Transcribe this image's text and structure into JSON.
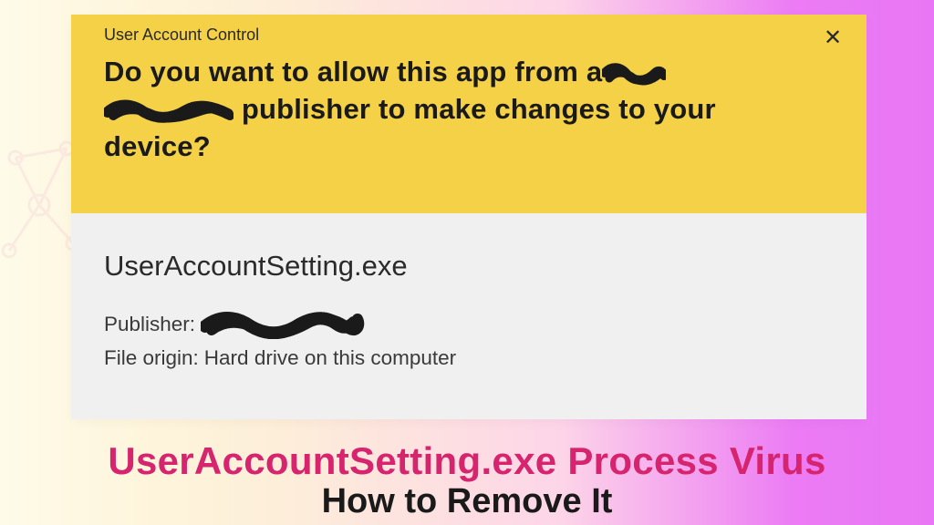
{
  "uac": {
    "title": "User Account Control",
    "question_line1": "Do you want to allow this app from a",
    "question_line2_suffix": "publisher to make changes to your",
    "question_line3": "device?",
    "close_glyph": "✕",
    "program_name": "UserAccountSetting.exe",
    "publisher_label": "Publisher:",
    "origin_label": "File origin:",
    "origin_value": "Hard drive on this computer"
  },
  "article": {
    "title": "UserAccountSetting.exe Process Virus",
    "subtitle": "How to Remove It"
  }
}
